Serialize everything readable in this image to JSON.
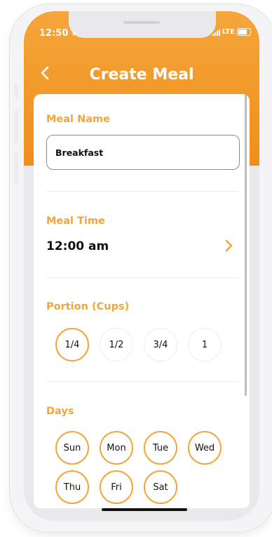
{
  "status": {
    "time": "12:50",
    "network": "LTE"
  },
  "header": {
    "title": "Create Meal"
  },
  "meal_name": {
    "label": "Meal Name",
    "value": "Breakfast"
  },
  "meal_time": {
    "label": "Meal Time",
    "value": "12:00 am"
  },
  "portion": {
    "label": "Portion (Cups)",
    "options": [
      "1/4",
      "1/2",
      "3/4",
      "1"
    ],
    "selected": "1/4"
  },
  "days": {
    "label": "Days",
    "options": [
      "Sun",
      "Mon",
      "Tue",
      "Wed",
      "Thu",
      "Fri",
      "Sat"
    ]
  },
  "colors": {
    "accent": "#f4a43b",
    "header_top": "#f5a53a",
    "header_bottom": "#ee8f1c"
  }
}
